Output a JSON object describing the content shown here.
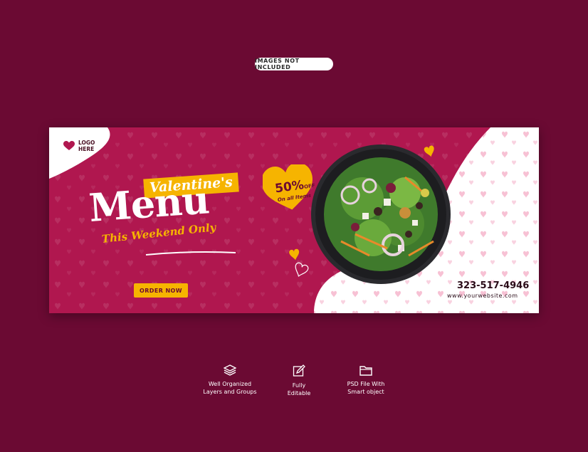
{
  "notice": "IMAGES NOT INCLUDED",
  "colors": {
    "background": "#6b0a33",
    "banner_pink": "#b0174f",
    "accent_yellow": "#f6b400",
    "white": "#ffffff"
  },
  "banner": {
    "logo": {
      "icon": "heart-icon",
      "line1": "LOGO",
      "line2": "HERE"
    },
    "headline_tag": "Valentine's",
    "headline_main": "Menu",
    "headline_sub": "This Weekend Only",
    "cta_label": "ORDER NOW",
    "discount": {
      "percent": "50%",
      "suffix": "OFF",
      "note": "On all Items"
    },
    "phone": "323-517-4946",
    "website": "www.yourwebsite.com",
    "image": "salad-plate"
  },
  "features": [
    {
      "icon": "layers-icon",
      "label": "Well Organized\nLayers and Groups"
    },
    {
      "icon": "edit-icon",
      "label": "Fully\nEditable"
    },
    {
      "icon": "folder-icon",
      "label": "PSD File With\nSmart object"
    }
  ]
}
